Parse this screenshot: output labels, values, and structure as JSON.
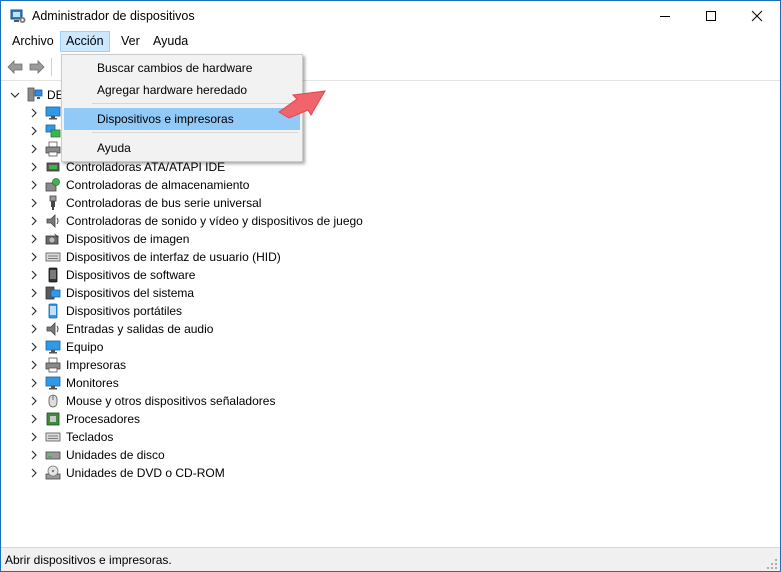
{
  "window": {
    "title": "Administrador de dispositivos",
    "controls": [
      "minimize",
      "maximize",
      "close"
    ]
  },
  "menubar": {
    "items": [
      {
        "label": "Archivo"
      },
      {
        "label": "Acción",
        "active": true
      },
      {
        "label": "Ver"
      },
      {
        "label": "Ayuda"
      }
    ]
  },
  "toolbar": {
    "buttons": [
      "back-icon",
      "forward-icon"
    ]
  },
  "dropdown": {
    "items": [
      {
        "label": "Buscar cambios de hardware"
      },
      {
        "label": "Agregar hardware heredado"
      },
      {
        "label": "Dispositivos e impresoras",
        "highlighted": true
      },
      {
        "label": "Ayuda"
      }
    ]
  },
  "tree": {
    "root": {
      "label": "DE",
      "expanded": true,
      "icon": "computer-icon"
    },
    "items": [
      {
        "label": "",
        "icon": "monitor-icon"
      },
      {
        "label": "",
        "icon": "network-icon"
      },
      {
        "label": "",
        "icon": "printer-icon"
      },
      {
        "label": "Controladoras ATA/ATAPI IDE",
        "icon": "ide-controller-icon"
      },
      {
        "label": "Controladoras de almacenamiento",
        "icon": "storage-controller-icon"
      },
      {
        "label": "Controladoras de bus serie universal",
        "icon": "usb-icon"
      },
      {
        "label": "Controladoras de sonido y vídeo y dispositivos de juego",
        "icon": "speaker-icon"
      },
      {
        "label": "Dispositivos de imagen",
        "icon": "camera-icon"
      },
      {
        "label": "Dispositivos de interfaz de usuario (HID)",
        "icon": "keyboard-icon"
      },
      {
        "label": "Dispositivos de software",
        "icon": "phone-icon"
      },
      {
        "label": "Dispositivos del sistema",
        "icon": "system-icon"
      },
      {
        "label": "Dispositivos portátiles",
        "icon": "portable-icon"
      },
      {
        "label": "Entradas y salidas de audio",
        "icon": "speaker-icon"
      },
      {
        "label": "Equipo",
        "icon": "monitor-icon"
      },
      {
        "label": "Impresoras",
        "icon": "printer-icon"
      },
      {
        "label": "Monitores",
        "icon": "monitor-icon"
      },
      {
        "label": "Mouse y otros dispositivos señaladores",
        "icon": "mouse-icon"
      },
      {
        "label": "Procesadores",
        "icon": "processor-icon"
      },
      {
        "label": "Teclados",
        "icon": "keyboard-icon"
      },
      {
        "label": "Unidades de disco",
        "icon": "disk-icon"
      },
      {
        "label": "Unidades de DVD o CD-ROM",
        "icon": "dvd-icon"
      }
    ]
  },
  "statusbar": {
    "text": "Abrir dispositivos e impresoras."
  },
  "colors": {
    "highlight": "#91c9f7",
    "menu_active_bg": "#cce8ff",
    "arrow": "#f0646b",
    "window_border": "#1e6fb9"
  }
}
